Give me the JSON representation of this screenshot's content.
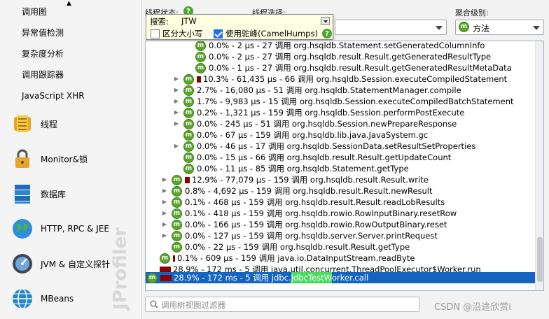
{
  "sidebar": {
    "sub_items": [
      "调用图",
      "异常值检测",
      "复杂度分析",
      "调用跟踪器",
      "JavaScript XHR"
    ],
    "main_items": [
      {
        "label": "线程",
        "icon": "threads-icon"
      },
      {
        "label": "Monitor&锁",
        "icon": "lock-icon"
      },
      {
        "label": "数据库",
        "icon": "database-icon"
      },
      {
        "label": "HTTP, RPC & JEE",
        "icon": "globe-icon"
      },
      {
        "label": "JVM & 自定义探针",
        "icon": "gauge-icon"
      },
      {
        "label": "MBeans",
        "icon": "mbeans-globe-icon"
      }
    ],
    "watermark": "JProfiler"
  },
  "toolbar": {
    "thread_state_label": "线程状态:",
    "thread_select_label": "线程选择:",
    "aggregation_label": "聚合级别:",
    "aggregation_value": "方法"
  },
  "search_popup": {
    "label": "搜索:",
    "value": "JTW",
    "case_sensitive_label": "区分大小写",
    "case_sensitive_checked": false,
    "camelhumps_label": "使用驼峰(CamelHumps)",
    "camelhumps_checked": true
  },
  "tree": {
    "rows": [
      {
        "indent": 3,
        "expander": false,
        "bar_pct": 0,
        "text": "0.0% - 2 µs - 27 调用 org.hsqldb.Statement.setGeneratedColumnInfo"
      },
      {
        "indent": 3,
        "expander": false,
        "bar_pct": 0,
        "text": "0.0% - 2 µs - 27 调用 org.hsqldb.result.Result.getGeneratedResultType"
      },
      {
        "indent": 3,
        "expander": false,
        "bar_pct": 0,
        "text": "0.0% - 1 µs - 27 调用 org.hsqldb.result.Result.getGeneratedResultMetaData"
      },
      {
        "indent": 2,
        "expander": true,
        "bar_pct": 10.3,
        "text": "10.3% - 61,435 µs - 66 调用 org.hsqldb.Session.executeCompiledStatement"
      },
      {
        "indent": 2,
        "expander": true,
        "bar_pct": 0,
        "text": "2.7% - 16,080 µs - 51 调用 org.hsqldb.StatementManager.compile"
      },
      {
        "indent": 2,
        "expander": true,
        "bar_pct": 0,
        "text": "1.7% - 9,983 µs - 15 调用 org.hsqldb.Session.executeCompiledBatchStatement"
      },
      {
        "indent": 2,
        "expander": true,
        "bar_pct": 0,
        "text": "0.2% - 1,321 µs - 159 调用 org.hsqldb.Session.performPostExecute"
      },
      {
        "indent": 2,
        "expander": true,
        "bar_pct": 0,
        "text": "0.0% - 245 µs - 51 调用 org.hsqldb.Session.newPrepareResponse"
      },
      {
        "indent": 2,
        "expander": false,
        "bar_pct": 0,
        "text": "0.0% - 67 µs - 159 调用 org.hsqldb.lib.java.JavaSystem.gc"
      },
      {
        "indent": 2,
        "expander": true,
        "bar_pct": 0,
        "text": "0.0% - 46 µs - 17 调用 org.hsqldb.SessionData.setResultSetProperties"
      },
      {
        "indent": 2,
        "expander": false,
        "bar_pct": 0,
        "text": "0.0% - 15 µs - 66 调用 org.hsqldb.result.Result.getUpdateCount"
      },
      {
        "indent": 2,
        "expander": false,
        "bar_pct": 0,
        "text": "0.0% - 11 µs - 85 调用 org.hsqldb.Statement.getType"
      },
      {
        "indent": 1,
        "expander": true,
        "bar_pct": 12.9,
        "text": "12.9% - 77,079 µs - 159 调用 org.hsqldb.result.Result.write"
      },
      {
        "indent": 1,
        "expander": true,
        "bar_pct": 0,
        "text": "0.8% - 4,692 µs - 159 调用 org.hsqldb.result.Result.newResult"
      },
      {
        "indent": 1,
        "expander": true,
        "bar_pct": 0,
        "text": "0.1% - 468 µs - 159 调用 org.hsqldb.result.Result.readLobResults"
      },
      {
        "indent": 1,
        "expander": true,
        "bar_pct": 0,
        "text": "0.1% - 418 µs - 159 调用 org.hsqldb.rowio.RowInputBinary.resetRow"
      },
      {
        "indent": 1,
        "expander": true,
        "bar_pct": 0,
        "text": "0.0% - 166 µs - 159 调用 org.hsqldb.rowio.RowOutputBinary.reset"
      },
      {
        "indent": 1,
        "expander": true,
        "bar_pct": 0,
        "text": "0.0% - 127 µs - 159 调用 org.hsqldb.server.Server.printRequest"
      },
      {
        "indent": 1,
        "expander": false,
        "bar_pct": 0,
        "text": "0.0% - 22 µs - 159 调用 org.hsqldb.result.Result.getType"
      },
      {
        "indent": 0,
        "expander": false,
        "bar_pct": 0.1,
        "text": "0.1% - 609 µs - 159 调用 java.io.DataInputStream.readByte"
      },
      {
        "indent": 0,
        "expander": false,
        "bar_pct": 28.9,
        "no_badge": true,
        "text": "28.9% - 172 ms - 5 调用 java.util.concurrent.ThreadPoolExecutor$Worker.run"
      }
    ],
    "selected_row": {
      "prefix": "28.9% - 172 ms - 5 调用 jdbc.",
      "match": "JdbcTestW",
      "suffix": "orker.call",
      "bar_pct": 28.9
    }
  },
  "filter": {
    "placeholder": "调用树视图过滤器"
  },
  "footer_watermark": "CSDN @沿途欣赏i",
  "colors": {
    "accent": "#1565c0",
    "method_badge": "#5aa62b",
    "time_bar": "#8b0000",
    "search_highlight": "#4cd964",
    "popup_bg": "#ffffe1"
  }
}
